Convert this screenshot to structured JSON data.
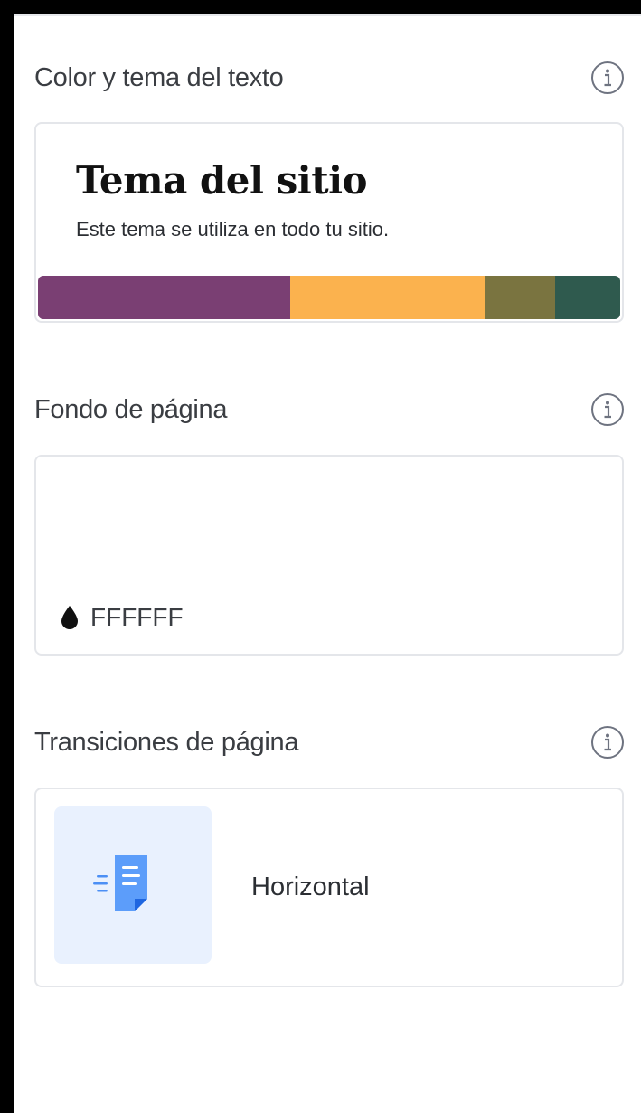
{
  "sections": {
    "theme": {
      "title": "Color y tema del texto",
      "card_title": "Tema del sitio",
      "card_desc": "Este tema se utiliza en todo tu sitio.",
      "palette": [
        "#7a3f73",
        "#fbb24e",
        "#7a7440",
        "#2f5a4e"
      ]
    },
    "background": {
      "title": "Fondo de página",
      "value": "FFFFFF"
    },
    "transitions": {
      "title": "Transiciones de página",
      "selected": "Horizontal"
    }
  },
  "icons": {
    "info": "info-circle-icon",
    "drop": "color-drop-icon",
    "transition": "document-slide-icon"
  }
}
